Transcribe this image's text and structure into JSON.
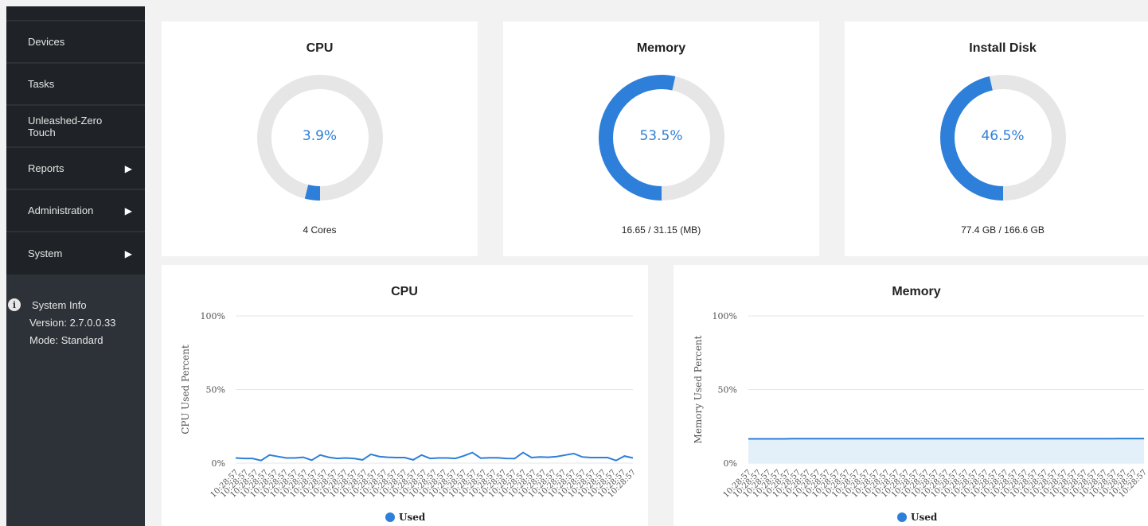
{
  "sidebar": {
    "items": [
      {
        "label": "Devices",
        "has_submenu": false
      },
      {
        "label": "Tasks",
        "has_submenu": false
      },
      {
        "label": "Unleashed-Zero Touch",
        "has_submenu": false
      },
      {
        "label": "Reports",
        "has_submenu": true
      },
      {
        "label": "Administration",
        "has_submenu": true
      },
      {
        "label": "System",
        "has_submenu": true
      }
    ],
    "system_info": {
      "title": "System Info",
      "version": "Version: 2.7.0.0.33",
      "mode": "Mode: Standard"
    }
  },
  "gauges": {
    "cpu": {
      "title": "CPU",
      "value_text": "3.9%",
      "percent": 3.9,
      "footer": "4 Cores"
    },
    "memory": {
      "title": "Memory",
      "value_text": "53.5%",
      "percent": 53.5,
      "footer": "16.65 / 31.15 (MB)"
    },
    "disk": {
      "title": "Install Disk",
      "value_text": "46.5%",
      "percent": 46.5,
      "footer": "77.4 GB / 166.6 GB"
    }
  },
  "colors": {
    "accent": "#2d7fd9",
    "track": "#e6e6e6",
    "area_fill": "#e3f0f9"
  },
  "chart_data": [
    {
      "type": "line",
      "title": "CPU",
      "ylabel": "CPU Used Percent",
      "yticks": [
        "100%",
        "50%",
        "0%"
      ],
      "ylim": [
        0,
        100
      ],
      "x_tick_label": "10:28:57",
      "x_count": 41,
      "series": [
        {
          "name": "Used",
          "values": [
            3.5,
            3.2,
            3.2,
            1.8,
            5.5,
            4.5,
            3.5,
            3.5,
            4,
            2,
            5.5,
            4,
            3.2,
            3.5,
            3.2,
            2.2,
            6,
            4.5,
            4,
            3.8,
            3.8,
            2.2,
            5.5,
            3.2,
            3.5,
            3.5,
            3.2,
            5,
            7.2,
            3.4,
            3.6,
            3.6,
            3.2,
            3.1,
            7.2,
            3.8,
            4.2,
            4,
            4.5,
            5.5,
            6.5,
            4.2,
            3.8,
            3.8,
            3.8,
            1.8,
            4.8,
            3.5
          ]
        }
      ]
    },
    {
      "type": "area",
      "title": "Memory",
      "ylabel": "Memory Used Percent",
      "yticks": [
        "100%",
        "50%",
        "0%"
      ],
      "ylim": [
        0,
        100
      ],
      "x_tick_label": "10:28:57",
      "x_count": 41,
      "series": [
        {
          "name": "Used",
          "values": [
            16.5,
            16.5,
            16.5,
            16.5,
            16.5,
            16.6,
            16.6,
            16.6,
            16.6,
            16.6,
            16.6,
            16.6,
            16.6,
            16.6,
            16.6,
            16.6,
            16.6,
            16.6,
            16.6,
            16.6,
            16.6,
            16.6,
            16.6,
            16.6,
            16.6,
            16.6,
            16.6,
            16.6,
            16.6,
            16.6,
            16.6,
            16.6,
            16.6,
            16.6,
            16.6,
            16.6,
            16.6,
            16.6,
            16.6,
            16.6,
            16.6,
            16.6,
            16.7,
            16.7,
            16.7,
            16.7
          ]
        }
      ]
    }
  ]
}
